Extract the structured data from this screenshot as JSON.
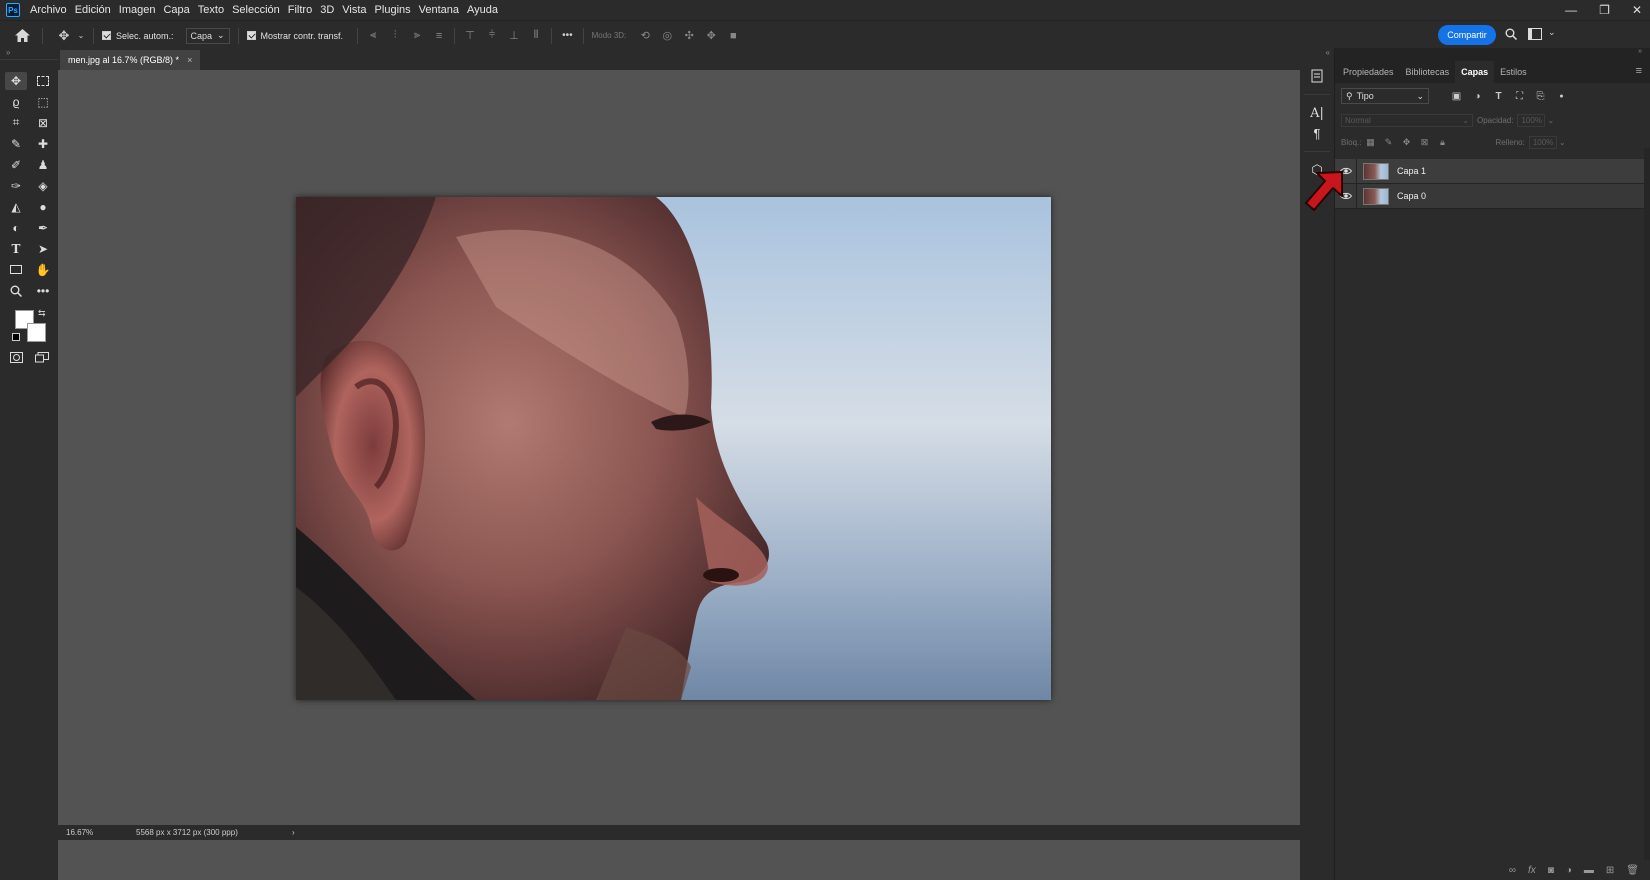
{
  "app": {
    "logo": "Ps"
  },
  "menu": [
    "Archivo",
    "Edición",
    "Imagen",
    "Capa",
    "Texto",
    "Selección",
    "Filtro",
    "3D",
    "Vista",
    "Plugins",
    "Ventana",
    "Ayuda"
  ],
  "options_bar": {
    "auto_select_label": "Selec. autom.:",
    "auto_select_value": "Capa",
    "show_transform_label": "Mostrar contr. transf.",
    "more": "•••",
    "mode3d_label": "Modo 3D:",
    "share_label": "Compartir"
  },
  "document": {
    "tab_title": "men.jpg al 16.7% (RGB/8) *",
    "close_glyph": "×"
  },
  "status": {
    "zoom": "16.67%",
    "doc_info": "5568 px x 3712 px (300 ppp)",
    "arrow": "›"
  },
  "layers_panel": {
    "tabs": [
      "Propiedades",
      "Bibliotecas",
      "Capas",
      "Estilos"
    ],
    "active_tab": "Capas",
    "filter_type": "Tipo",
    "blend_mode": "Normal",
    "opacity_label": "Opacidad:",
    "opacity_value": "100%",
    "lock_label": "Bloq.:",
    "fill_label": "Relleno:",
    "fill_value": "100%",
    "layers": [
      {
        "name": "Capa 1",
        "visible": true,
        "selected": true
      },
      {
        "name": "Capa 0",
        "visible": true,
        "selected": false
      }
    ]
  },
  "colors": {
    "accent": "#1473e6",
    "annotation_arrow": "#c8161d",
    "chrome_dark": "#2b2b2b",
    "canvas_bg": "#535353"
  }
}
